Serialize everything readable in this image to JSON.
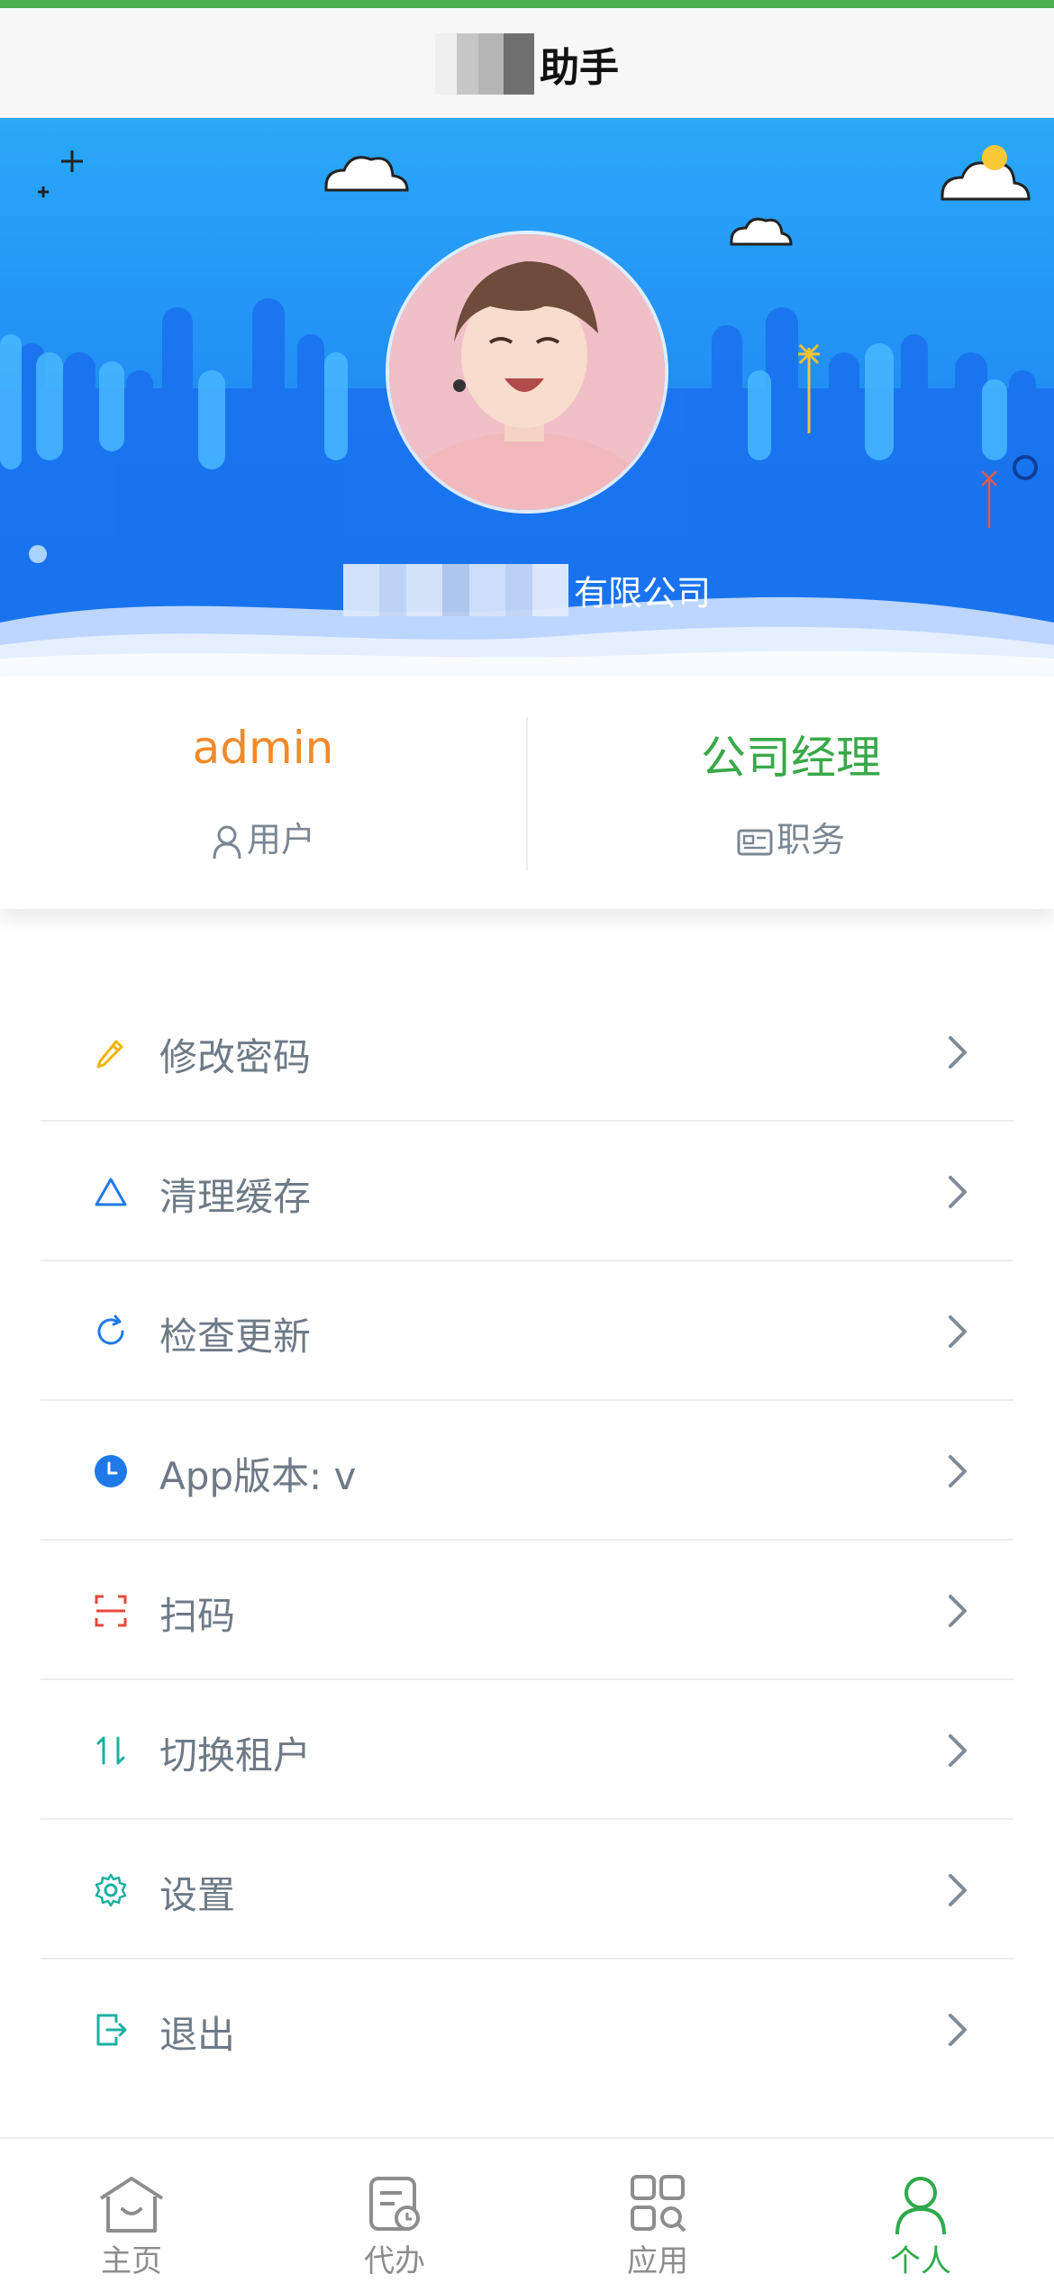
{
  "header": {
    "title_suffix": "助手"
  },
  "profile": {
    "company_suffix": "有限公司"
  },
  "stats": {
    "user": {
      "value": "admin",
      "label": "用户"
    },
    "role": {
      "value": "公司经理",
      "label": "职务"
    }
  },
  "menu": [
    {
      "label": "修改密码",
      "icon": "pencil-icon",
      "color": "#f5b400"
    },
    {
      "label": "清理缓存",
      "icon": "triangle-icon",
      "color": "#1f7ae8"
    },
    {
      "label": "检查更新",
      "icon": "refresh-icon",
      "color": "#1f7ae8"
    },
    {
      "label": "App版本: v",
      "icon": "clock-icon",
      "color": "#1f7ae8"
    },
    {
      "label": "扫码",
      "icon": "scan-icon",
      "color": "#e8473a"
    },
    {
      "label": "切换租户",
      "icon": "swap-icon",
      "color": "#1bb0a0"
    },
    {
      "label": "设置",
      "icon": "gear-icon",
      "color": "#1bb0a0"
    },
    {
      "label": "退出",
      "icon": "logout-icon",
      "color": "#1bb0a0"
    }
  ],
  "tabbar": [
    {
      "label": "主页",
      "icon": "home-icon"
    },
    {
      "label": "代办",
      "icon": "todo-icon"
    },
    {
      "label": "应用",
      "icon": "apps-icon"
    },
    {
      "label": "个人",
      "icon": "person-icon",
      "active": true
    }
  ],
  "colors": {
    "accent_green": "#2eaa4a",
    "hero_blue": "#1e8cf4",
    "orange": "#f08a2b"
  }
}
